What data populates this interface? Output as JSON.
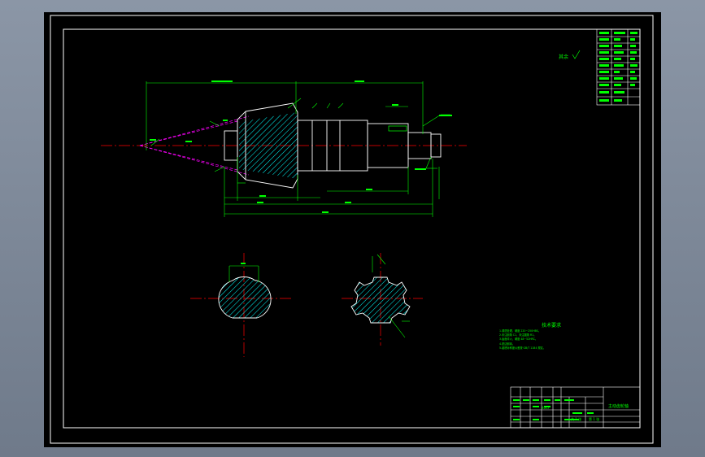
{
  "drawing": {
    "roughness_note": "其余",
    "title_block": {
      "part_name": "主动齿轮轴",
      "scale_text": "共 1 张",
      "sheet_text": "第 1 张",
      "material": "40Cr"
    },
    "tech_requirements": {
      "title": "技术要求",
      "lines": [
        "1.调质处理，硬度 220~250HBS。",
        "2.未注倒角 C1，未注圆角 R1。",
        "3.齿面淬火，硬度 48~52HRC。",
        "4.锐边倒钝。",
        "5.键槽对称度公差按 GB/T 1184 规定。"
      ]
    },
    "colors": {
      "sheet": "#000000",
      "frame": "#ffffff",
      "geometry": "#00ff00",
      "centerline": "#ff0000",
      "construction": "#ff00ff",
      "hatch": "#00ffff",
      "dimensions": "#00ff00"
    }
  }
}
